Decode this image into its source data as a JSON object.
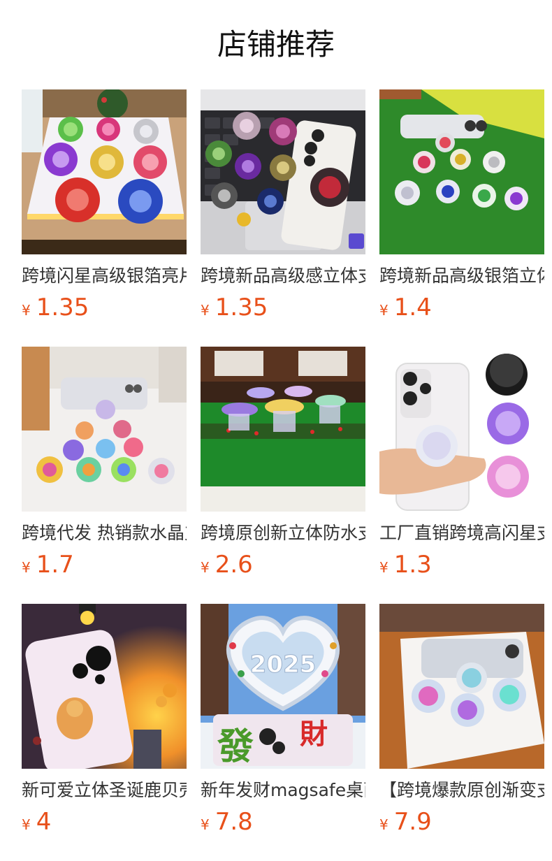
{
  "page": {
    "title": "店铺推荐"
  },
  "currency_symbol": "¥",
  "colors": {
    "price": "#e8501a",
    "title": "#111111",
    "product_name": "#333333"
  },
  "products": [
    {
      "name": "跨境闪星高级银箔亮片手机支架",
      "price": "1.35",
      "image": "glitter-grips-on-white-display"
    },
    {
      "name": "跨境新品高级感立体支架",
      "price": "1.35",
      "image": "glitter-grips-on-laptop-with-phone"
    },
    {
      "name": "跨境新品高级银箔立体支架",
      "price": "1.4",
      "image": "glitter-grips-on-green-field"
    },
    {
      "name": "跨境代发 热销款水晶支架",
      "price": "1.7",
      "image": "rainbow-grips-on-white-table"
    },
    {
      "name": "跨境原创新立体防水支架",
      "price": "2.6",
      "image": "purple-grips-with-garland"
    },
    {
      "name": "工厂直销跨境高闪星支架",
      "price": "1.3",
      "image": "hand-holding-phone-with-grip"
    },
    {
      "name": "新可爱立体圣诞鹿贝壳纹支架",
      "price": "4",
      "image": "phone-case-with-deer-sunset"
    },
    {
      "name": "新年发财magsafe桌面支架",
      "price": "7.8",
      "image": "new-year-2025-heart-fa-cai"
    },
    {
      "name": "【跨境爆款原创渐变支架",
      "price": "7.9",
      "image": "gradient-grips-on-wood-table"
    }
  ]
}
